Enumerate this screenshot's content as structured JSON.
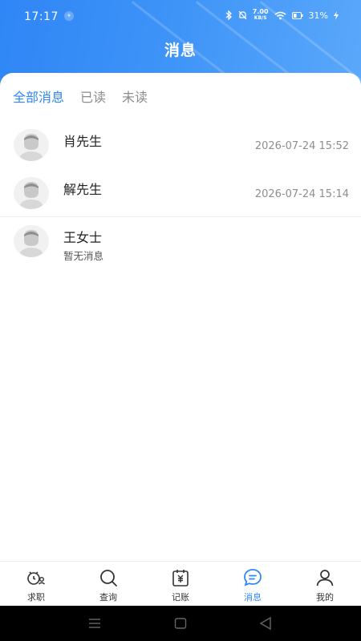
{
  "status_bar": {
    "time": "17:17",
    "net_speed_value": "7.00",
    "net_speed_unit": "KB/S",
    "battery": "31%"
  },
  "header": {
    "title": "消息"
  },
  "tabs": [
    {
      "label": "全部消息",
      "active": true
    },
    {
      "label": "已读",
      "active": false
    },
    {
      "label": "未读",
      "active": false
    }
  ],
  "messages": [
    {
      "name": "肖先生",
      "time": "2026-07-24 15:52",
      "preview": ""
    },
    {
      "name": "解先生",
      "time": "2026-07-24 15:14",
      "preview": ""
    },
    {
      "name": "王女士",
      "time": "",
      "preview": "暂无消息"
    }
  ],
  "bottom_nav": [
    {
      "label": "求职",
      "icon": "job-search-icon",
      "active": false
    },
    {
      "label": "查询",
      "icon": "search-icon",
      "active": false
    },
    {
      "label": "记账",
      "icon": "ledger-icon",
      "active": false
    },
    {
      "label": "消息",
      "icon": "message-icon",
      "active": true
    },
    {
      "label": "我的",
      "icon": "profile-icon",
      "active": false
    }
  ],
  "colors": {
    "accent": "#2f86f6",
    "header_gradient_start": "#2f86f6",
    "header_gradient_end": "#5aa8fb",
    "muted_text": "#8c8c8c"
  }
}
